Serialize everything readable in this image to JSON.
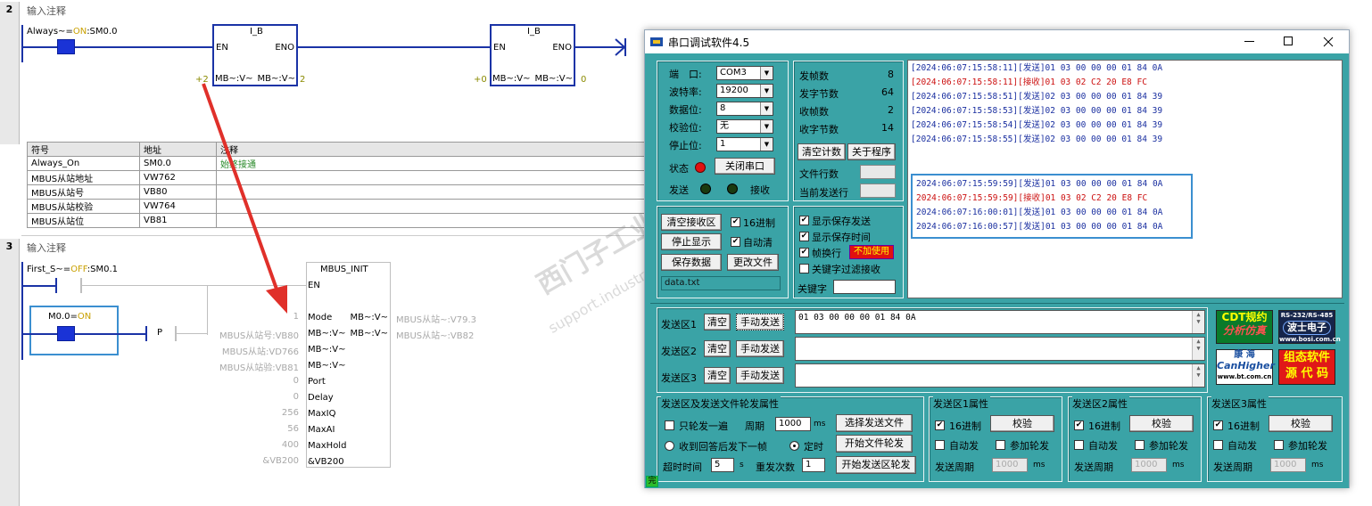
{
  "ladder": {
    "network2": {
      "num": "2",
      "title": "输入注释"
    },
    "network3": {
      "num": "3",
      "title": "输入注释"
    },
    "always_label": "Always~",
    "always_eq": "=",
    "always_on": "ON",
    "always_addr": ":SM0.0",
    "ib_title": "I_B",
    "en": "EN",
    "eno": "ENO",
    "mb_v": "MB~:V~",
    "ib1_in": "+2",
    "ib1_out": "2",
    "ib2_in": "+0",
    "ib2_out": "0",
    "symtable": {
      "headers": [
        "符号",
        "地址",
        "注释"
      ],
      "rows": [
        [
          "Always_On",
          "SM0.0",
          "始终接通"
        ],
        [
          "MBUS从站地址",
          "VW762",
          ""
        ],
        [
          "MBUS从站号",
          "VB80",
          ""
        ],
        [
          "MBUS从站校验",
          "VW764",
          ""
        ],
        [
          "MBUS从站位",
          "VB81",
          ""
        ]
      ]
    },
    "first_label": "First_S~",
    "first_eq": "=",
    "first_off": "OFF",
    "first_addr": ":SM0.1",
    "m00_label": "M0.0",
    "m00_eq": "=",
    "m00_on": "ON",
    "p_label": "P",
    "mbus_init": {
      "title": "MBUS_INIT",
      "en": "EN",
      "pins": [
        {
          "name": "Mode",
          "left": "1"
        },
        {
          "name": "MB~:V~",
          "left": "MBUS从站号:VB80"
        },
        {
          "name": "MB~:V~",
          "left": "MBUS从站:VD766"
        },
        {
          "name": "MB~:V~",
          "left": "MBUS从站验:VB81"
        },
        {
          "name": "Port",
          "left": "0"
        },
        {
          "name": "Delay",
          "left": "0"
        },
        {
          "name": "MaxIQ",
          "left": "256"
        },
        {
          "name": "MaxAI",
          "left": "56"
        },
        {
          "name": "MaxHold",
          "left": "400"
        },
        {
          "name": "&VB200",
          "left": "&VB200"
        }
      ],
      "outs": [
        {
          "name": "MB~:V~",
          "right": "MBUS从站~:V79.3"
        },
        {
          "name": "MB~:V~",
          "right": "MBUS从站~:VB82"
        }
      ]
    }
  },
  "watermark": {
    "line1": "西门子工业支持中心",
    "line2": "support.industry.siemens.com"
  },
  "serial": {
    "title": "串口调试软件4.5",
    "port": {
      "label": "端　口:",
      "value": "COM3"
    },
    "baud": {
      "label": "波特率:",
      "value": "19200"
    },
    "databits": {
      "label": "数据位:",
      "value": "8"
    },
    "parity": {
      "label": "校验位:",
      "value": "无"
    },
    "stopbits": {
      "label": "停止位:",
      "value": "1"
    },
    "status_label": "状态",
    "close_port": "关闭串口",
    "send_led": "发送",
    "recv_led": "接收",
    "stats": [
      {
        "label": "发帧数",
        "value": "8"
      },
      {
        "label": "发字节数",
        "value": "64"
      },
      {
        "label": "收帧数",
        "value": "2"
      },
      {
        "label": "收字节数",
        "value": "14"
      }
    ],
    "clear_count": "清空计数",
    "about": "关于程序",
    "file_lines": "文件行数",
    "cur_send_line": "当前发送行",
    "clear_recv": "清空接收区",
    "hex16_a": "16进制",
    "stop_display": "停止显示",
    "auto_clear": "自动清",
    "save_data": "保存数据",
    "change_file": "更改文件",
    "file_name": "data.txt",
    "show_save_send": "显示保存发送",
    "show_save_time": "显示保存时间",
    "frame_wrap": "帧换行",
    "not_used": "不加使用",
    "keyword_filter": "关键字过滤接收",
    "keyword": "关键字",
    "log1": [
      {
        "text": "[2024:06:07:15:58:11][发送]01 03 00 00 00 01 84 0A",
        "color": "#1a2fa0"
      },
      {
        "text": "[2024:06:07:15:58:11][接收]01 03 02 C2 20 E8 FC",
        "color": "#cc1010"
      },
      {
        "text": "[2024:06:07:15:58:51][发送]02 03 00 00 00 01 84 39",
        "color": "#1a2fa0"
      },
      {
        "text": "[2024:06:07:15:58:53][发送]02 03 00 00 00 01 84 39",
        "color": "#1a2fa0"
      },
      {
        "text": "[2024:06:07:15:58:54][发送]02 03 00 00 00 01 84 39",
        "color": "#1a2fa0"
      },
      {
        "text": "[2024:06:07:15:58:55][发送]02 03 00 00 00 01 84 39",
        "color": "#1a2fa0"
      }
    ],
    "log2": [
      {
        "text": "2024:06:07:15:59:59][发送]01 03 00 00 00 01 84 0A",
        "color": "#1a2fa0"
      },
      {
        "text": "2024:06:07:15:59:59][接收]01 03 02 C2 20 E8 FC",
        "color": "#cc1010"
      },
      {
        "text": "2024:06:07:16:00:01][发送]01 03 00 00 00 01 84 0A",
        "color": "#1a2fa0"
      },
      {
        "text": "2024:06:07:16:00:57][发送]01 03 00 00 00 01 84 0A",
        "color": "#1a2fa0"
      }
    ],
    "send_areas": [
      {
        "label": "发送区1",
        "clear": "清空",
        "send": "手动发送",
        "value": "01 03 00 00 00 01 84 0A"
      },
      {
        "label": "发送区2",
        "clear": "清空",
        "send": "手动发送",
        "value": ""
      },
      {
        "label": "发送区3",
        "clear": "清空",
        "send": "手动发送",
        "value": ""
      }
    ],
    "ads": {
      "cdt1": "CDT规约",
      "cdt2": "分析仿真",
      "rs_top": "RS-232/RS-485",
      "rs_mid": "波士电子",
      "rs_url": "www.bosi.com.cn",
      "kh1": "康 海",
      "kh2": "CanHigher",
      "kh_url": "www.bt.com.cn",
      "zt1": "组态软件",
      "zt2": "源 代 码"
    },
    "file_group": {
      "title": "发送区及发送文件轮发属性",
      "once": "只轮发一遍",
      "period": "周期",
      "period_val": "1000",
      "ms": "ms",
      "select_file": "选择发送文件",
      "recv_next": "收到回答后发下一帧",
      "timer": "定时",
      "start_file": "开始文件轮发",
      "timeout": "超时时间",
      "timeout_val": "5",
      "s": "s",
      "resend": "重发次数",
      "resend_val": "1",
      "start_area": "开始发送区轮发"
    },
    "area_groups": [
      {
        "title": "发送区1属性",
        "hex": "16进制",
        "check": "校验",
        "auto": "自动发",
        "join": "参加轮发",
        "period": "发送周期",
        "period_val": "1000",
        "ms": "ms"
      },
      {
        "title": "发送区2属性",
        "hex": "16进制",
        "check": "校验",
        "auto": "自动发",
        "join": "参加轮发",
        "period": "发送周期",
        "period_val": "1000",
        "ms": "ms"
      },
      {
        "title": "发送区3属性",
        "hex": "16进制",
        "check": "校验",
        "auto": "自动发",
        "join": "参加轮发",
        "period": "发送周期",
        "period_val": "1000",
        "ms": "ms"
      }
    ],
    "status_corner": "完"
  },
  "colors": {
    "rail": "#1a33a6",
    "accent": "#3aa3a6",
    "arrow": "#e0302a",
    "on": "#c9a000"
  }
}
